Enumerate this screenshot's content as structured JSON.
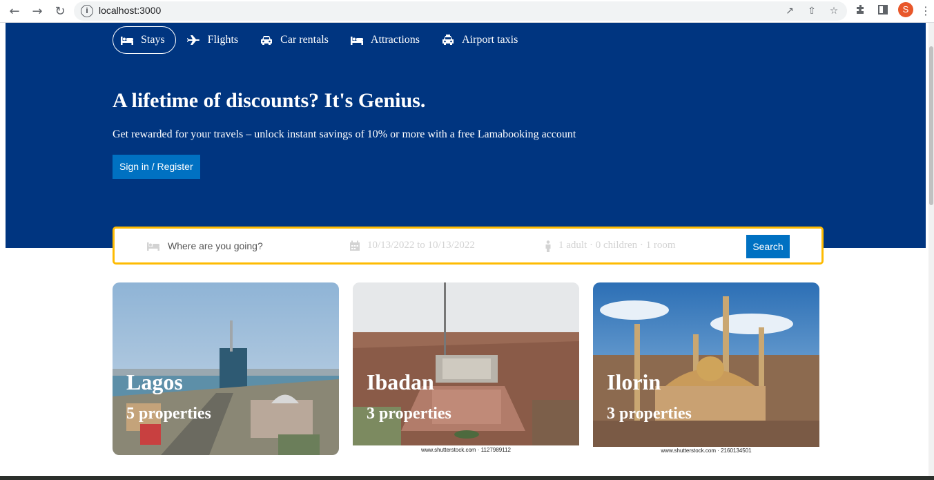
{
  "browser": {
    "url": "localhost:3000",
    "avatar_letter": "S",
    "icons": [
      "back-arrow-icon",
      "forward-arrow-icon",
      "reload-icon",
      "info-icon",
      "open-in-new-icon",
      "share-icon",
      "star-icon",
      "extensions-icon",
      "side-panel-icon",
      "kebab-menu-icon"
    ]
  },
  "header": {
    "nav": [
      {
        "label": "Stays",
        "icon": "bed-icon",
        "active": true
      },
      {
        "label": "Flights",
        "icon": "plane-icon",
        "active": false
      },
      {
        "label": "Car rentals",
        "icon": "car-icon",
        "active": false
      },
      {
        "label": "Attractions",
        "icon": "bed-icon",
        "active": false
      },
      {
        "label": "Airport taxis",
        "icon": "taxi-icon",
        "active": false
      }
    ],
    "title": "A lifetime of discounts? It's Genius.",
    "description": "Get rewarded for your travels – unlock instant savings of 10% or more with a free Lamabooking account",
    "cta_label": "Sign in / Register"
  },
  "search": {
    "destination_placeholder": "Where are you going?",
    "dates": "10/13/2022 to 10/13/2022",
    "options": "1 adult · 0 children · 1 room",
    "button_label": "Search"
  },
  "featured": [
    {
      "city": "Lagos",
      "properties": "5 properties",
      "watermark": ""
    },
    {
      "city": "Ibadan",
      "properties": "3 properties",
      "watermark": "www.shutterstock.com · 1127989112"
    },
    {
      "city": "Ilorin",
      "properties": "3 properties",
      "watermark": "www.shutterstock.com · 2160134501"
    }
  ],
  "colors": {
    "brand_blue": "#003580",
    "button_blue": "#0071c2",
    "search_border": "#febb02"
  }
}
